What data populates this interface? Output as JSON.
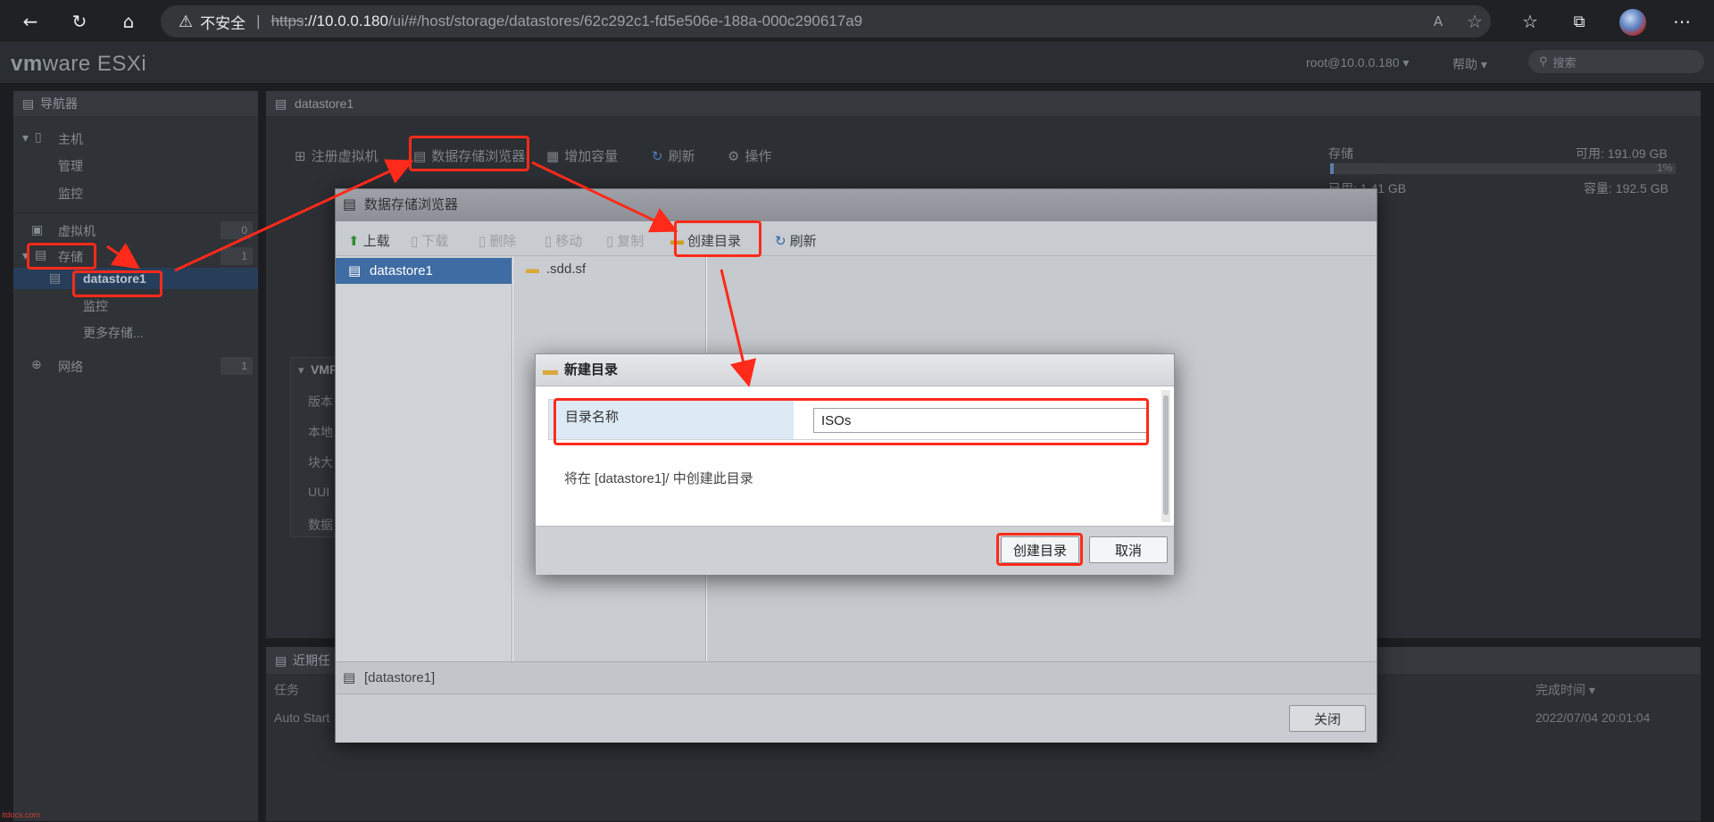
{
  "browser": {
    "security_label": "不安全",
    "url_scheme": "https",
    "url_host": "://10.0.0.180",
    "url_path": "/ui/#/host/storage/datastores/62c292c1-fd5e506e-188a-000c290617a9"
  },
  "header": {
    "brand_vm": "vm",
    "brand_rest": "ware ESXi",
    "user": "root@10.0.0.180 ▾",
    "help": "帮助 ▾",
    "search_placeholder": "搜索"
  },
  "nav": {
    "title": "导航器",
    "items": [
      {
        "label": "主机"
      },
      {
        "label": "管理"
      },
      {
        "label": "监控"
      },
      {
        "label": "虚拟机",
        "badge": "0"
      },
      {
        "label": "存储",
        "badge": "1"
      },
      {
        "label": "datastore1"
      },
      {
        "label": "监控"
      },
      {
        "label": "更多存储..."
      },
      {
        "label": "网络",
        "badge": "1"
      }
    ]
  },
  "main": {
    "title": "datastore1",
    "toolbar": [
      "注册虚拟机",
      "数据存储浏览器",
      "增加容量",
      "刷新",
      "操作"
    ],
    "storage": {
      "label": "存储",
      "free": "可用: 191.09 GB",
      "pct": "1%",
      "used": "已用: 1.41 GB",
      "capacity": "容量: 192.5 GB"
    },
    "vm_panel_title": "VMF",
    "vm_rows": [
      "版本",
      "本地",
      "块大",
      "UUI",
      "数据"
    ]
  },
  "tasks": {
    "title": "近期任",
    "col_task": "任务",
    "col_time": "完成时间 ▾",
    "row_task": "Auto Start",
    "row_time": "2022/07/04 20:01:04"
  },
  "ds_browser": {
    "title": "数据存储浏览器",
    "toolbar": {
      "upload": "上载",
      "download": "下载",
      "delete": "删除",
      "move": "移动",
      "copy": "复制",
      "mkdir": "创建目录",
      "refresh": "刷新"
    },
    "datastore": "datastore1",
    "folder": ".sdd.sf",
    "status": "[datastore1]",
    "close": "关闭"
  },
  "new_dir": {
    "title": "新建目录",
    "field_label": "目录名称",
    "field_value": "ISOs",
    "info": "将在 [datastore1]/ 中创建此目录",
    "create": "创建目录",
    "cancel": "取消"
  },
  "watermark": "itdocs.com",
  "colors": {
    "annotation": "#ff2a1a",
    "selection": "#3e6ca3"
  }
}
